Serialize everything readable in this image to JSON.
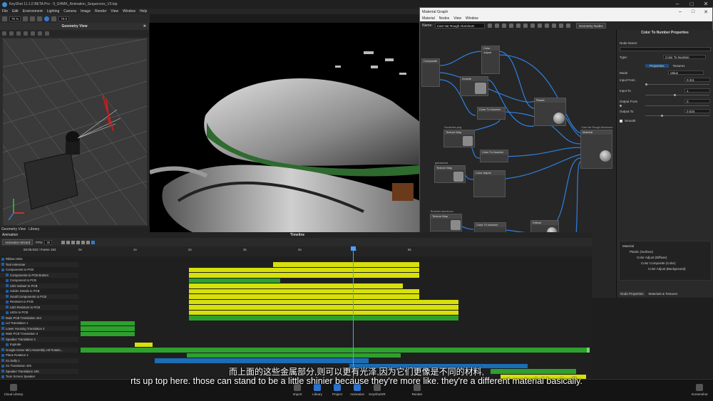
{
  "app": {
    "title": "KeyShot 11.1.0 BETA Pro - 9_GHMK_Animation_Sequences_V3.bip",
    "menu": [
      "File",
      "Edit",
      "Environment",
      "Lighting",
      "Camera",
      "Image",
      "Render",
      "View",
      "Window",
      "Help"
    ],
    "zoom": "75 %",
    "fps_field": "70.0"
  },
  "geometry_view": {
    "title": "Geometry View",
    "tabs": [
      "Geometry View",
      "Library"
    ]
  },
  "material_graph": {
    "title": "Material Graph",
    "menu": [
      "Material",
      "Nodes",
      "View",
      "Window"
    ],
    "name_label": "Name:",
    "name_value": "Cast Var Rough Aluminum",
    "geometry_nodes_btn": "Geometry Nodes",
    "nodes": {
      "composite": "Composite",
      "color_adjust_1": "Color Adjust",
      "granite": "Granite",
      "plastic_1": "Plastic",
      "color_to_number_1": "Color To Number",
      "material": "Material",
      "material_caption": "Cast Var Rough Aluminum",
      "texture_map_1": "Texture Map",
      "texture_map_1_caption": "Scratches.png",
      "color_to_number_2": "Color To Number",
      "texture_map_2": "Texture Map",
      "texture_map_2_caption": "galvanized",
      "color_adjust_2": "Color Adjust",
      "texture_map_3": "Texture Map",
      "texture_map_3_caption": "Brushed aluminum",
      "color_to_number_3": "Color To Number",
      "diffuse": "Diffuse",
      "texture_map_4": "Texture Map",
      "texture_map_4_caption": "Speckle Mono",
      "color_to_number_4": "Color To Number",
      "plastic_2": "Plastic"
    },
    "properties": {
      "title": "Color To Number Properties",
      "node_name_label": "Node Name:",
      "node_name_value": "",
      "type_label": "Type:",
      "type_value": "Color To Number",
      "tabs": [
        "Properties",
        "Textures"
      ],
      "mode_label": "Mode",
      "mode_value": "Value",
      "input_from_label": "Input From",
      "input_from_value": "0.311",
      "input_to_label": "Input To",
      "input_to_value": "1",
      "output_from_label": "Output From",
      "output_from_value": "0",
      "output_to_label": "Output To",
      "output_to_value": "0.034",
      "smooth_label": "Smooth",
      "tree": [
        "Material",
        "Plastic (Surface)",
        "Color Adjust (Diffuse)",
        "Color Composite (Color)",
        "Color Adjust (Background)"
      ],
      "bottom_tabs": [
        "Node Properties",
        "Materials & Textures"
      ]
    }
  },
  "animation": {
    "panel_label": "Animation",
    "timeline_label": "Timeline",
    "wizard_btn": "Animation Wizard",
    "fps_label": "FPS:",
    "fps_value": "30",
    "time_readout": "00:05:033 / Frame 152",
    "ruler_marks": [
      "0s",
      "1s",
      "2s",
      "3s",
      "4s",
      "5s",
      "6s"
    ],
    "tracks": [
      "Ribbon Wire",
      "Tool Antennae",
      "Components to PCB",
      "Components to PCB Bottom",
      "Component to PCB",
      "LED Isolator to PCB",
      "Solder Details to PCB",
      "Small Components to PCB",
      "Resistors to PCB",
      "LED Resistors to PCB",
      "LEDs to PCB",
      "Main PCB Translation 424",
      "Lid Translation 1",
      "Lower Housing Translation 2",
      "Main PCB Translation 3",
      "Speaker Translation 4",
      "Explode",
      "Google Home Mini Assembly e4l Rotatio...",
      "Plane Rotation 2",
      "S1 Dolly 1",
      "S1 Translation 425",
      "Speaker Translation 435",
      "Toon Screen Speaker"
    ]
  },
  "bottom_bar": {
    "cloud_library": "Cloud Library",
    "tabs": [
      "Import",
      "Library",
      "Project",
      "Animation",
      "KeyShotXR",
      "Render"
    ],
    "screenshot": "Screenshot"
  },
  "subtitles": {
    "zh": "而上面的这些金属部分,则可以更有光泽,因为它们更像是不同的材料,",
    "en": "rts up top here. those can stand to be a little shinier because they're more like. they're a different material basically."
  },
  "colors": {
    "accent": "#2e7bd6",
    "green": "#2ea02e",
    "yellow": "#d7e00a",
    "blue": "#1b6db5"
  }
}
